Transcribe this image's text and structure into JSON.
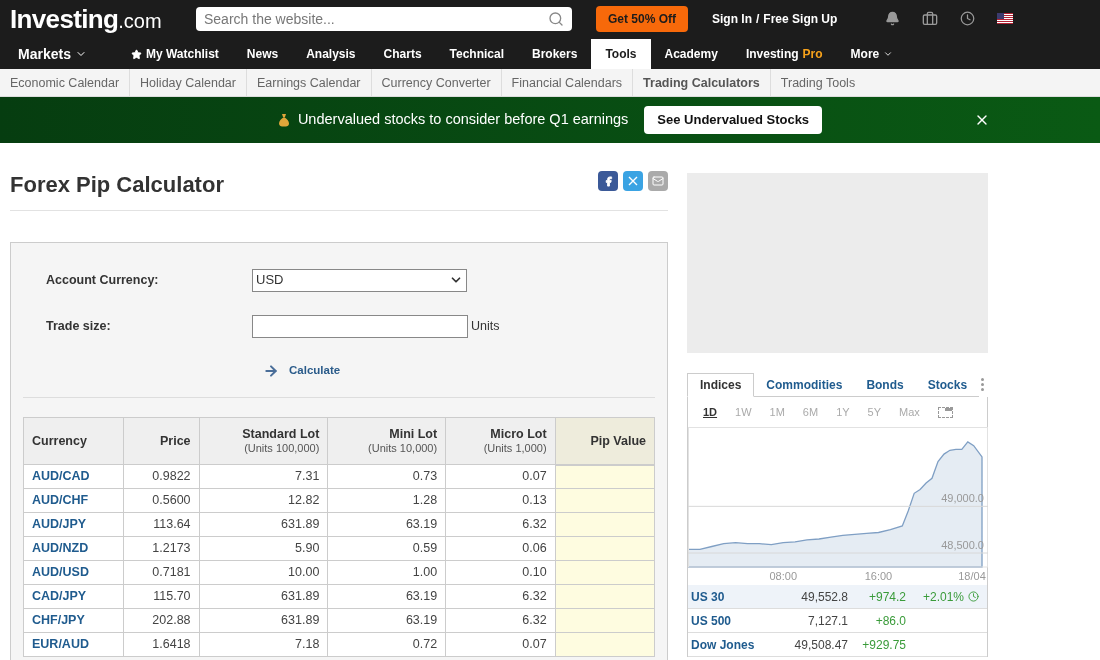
{
  "header": {
    "logo_main": "Investing",
    "logo_suffix": ".com",
    "search": {
      "placeholder": "Search the website..."
    },
    "promo_button": "Get 50% Off",
    "sign_in": "Sign In",
    "separator": "/",
    "sign_up": "Free Sign Up"
  },
  "nav": [
    {
      "label": "Markets",
      "selected": false,
      "kind": "dropdown"
    },
    {
      "label": "My Watchlist",
      "selected": false,
      "kind": "star"
    },
    {
      "label": "News",
      "selected": false,
      "kind": "plain"
    },
    {
      "label": "Analysis",
      "selected": false,
      "kind": "plain"
    },
    {
      "label": "Charts",
      "selected": false,
      "kind": "plain"
    },
    {
      "label": "Technical",
      "selected": false,
      "kind": "plain"
    },
    {
      "label": "Brokers",
      "selected": false,
      "kind": "plain"
    },
    {
      "label": "Tools",
      "selected": true,
      "kind": "plain"
    },
    {
      "label": "Academy",
      "selected": false,
      "kind": "plain"
    },
    {
      "label": "Investing",
      "label_accent": "Pro",
      "selected": false,
      "kind": "pro"
    },
    {
      "label": "More",
      "selected": false,
      "kind": "caret"
    }
  ],
  "subnav": [
    {
      "label": "Economic Calendar",
      "selected": false
    },
    {
      "label": "Holiday Calendar",
      "selected": false
    },
    {
      "label": "Earnings Calendar",
      "selected": false
    },
    {
      "label": "Currency Converter",
      "selected": false
    },
    {
      "label": "Financial Calendars",
      "selected": false
    },
    {
      "label": "Trading Calculators",
      "selected": true
    },
    {
      "label": "Trading Tools",
      "selected": false
    }
  ],
  "banner": {
    "text": "Undervalued stocks to consider before Q1 earnings",
    "button": "See Undervalued Stocks"
  },
  "page_title": "Forex Pip Calculator",
  "form": {
    "currency_label": "Account Currency:",
    "currency_value": "USD",
    "trade_size_label": "Trade size:",
    "trade_size_unit": "Units",
    "calculate": "Calculate"
  },
  "table": {
    "columns": [
      {
        "title": "Currency"
      },
      {
        "title": "Price"
      },
      {
        "title": "Standard Lot",
        "subtitle": "(Units 100,000)"
      },
      {
        "title": "Mini Lot",
        "subtitle": "(Units 10,000)"
      },
      {
        "title": "Micro Lot",
        "subtitle": "(Units 1,000)"
      },
      {
        "title": "Pip Value"
      }
    ],
    "rows": [
      [
        "AUD/CAD",
        "0.9822",
        "7.31",
        "0.73",
        "0.07"
      ],
      [
        "AUD/CHF",
        "0.5600",
        "12.82",
        "1.28",
        "0.13"
      ],
      [
        "AUD/JPY",
        "113.64",
        "631.89",
        "63.19",
        "6.32"
      ],
      [
        "AUD/NZD",
        "1.2173",
        "5.90",
        "0.59",
        "0.06"
      ],
      [
        "AUD/USD",
        "0.7181",
        "10.00",
        "1.00",
        "0.10"
      ],
      [
        "CAD/JPY",
        "115.70",
        "631.89",
        "63.19",
        "6.32"
      ],
      [
        "CHF/JPY",
        "202.88",
        "631.89",
        "63.19",
        "6.32"
      ],
      [
        "EUR/AUD",
        "1.6418",
        "7.18",
        "0.72",
        "0.07"
      ]
    ]
  },
  "markets": {
    "tabs": [
      {
        "label": "Indices",
        "selected": true
      },
      {
        "label": "Commodities",
        "selected": false
      },
      {
        "label": "Bonds",
        "selected": false
      },
      {
        "label": "Stocks",
        "selected": false
      }
    ],
    "periods": [
      {
        "label": "1D",
        "selected": true
      },
      {
        "label": "1W",
        "selected": false
      },
      {
        "label": "1M",
        "selected": false
      },
      {
        "label": "6M",
        "selected": false
      },
      {
        "label": "1Y",
        "selected": false
      },
      {
        "label": "5Y",
        "selected": false
      },
      {
        "label": "Max",
        "selected": false
      }
    ],
    "chart_data": {
      "type": "area",
      "x": [
        0,
        1,
        2,
        3,
        4,
        5,
        6,
        7,
        8,
        9,
        10,
        11,
        12,
        13,
        14,
        15,
        16,
        17,
        18,
        18.5,
        19,
        19.5,
        20,
        20.5,
        21,
        21.5,
        22,
        22.5,
        23,
        23.5,
        24,
        24.7
      ],
      "series": [
        {
          "color": "#7f9fc4",
          "values": [
            48540,
            48540,
            48570,
            48600,
            48610,
            48600,
            48600,
            48590,
            48610,
            48620,
            48640,
            48650,
            48670,
            48690,
            48700,
            48710,
            48720,
            48750,
            48790,
            48950,
            49140,
            49180,
            49250,
            49300,
            49480,
            49560,
            49600,
            49610,
            49610,
            49690,
            49650,
            49530
          ]
        }
      ],
      "xlim": [
        0,
        25.2
      ],
      "ylim": [
        48350,
        49850
      ],
      "xticks": [
        {
          "value": 8,
          "label": "08:00"
        },
        {
          "value": 16,
          "label": "16:00"
        },
        {
          "value": 24,
          "label": "18/04"
        }
      ],
      "yticks": [
        {
          "value": 49000,
          "label": "49,000.0"
        },
        {
          "value": 48500,
          "label": "48,500.0"
        }
      ]
    },
    "quotes": [
      {
        "name": "US 30",
        "last": "49,552.8",
        "change": "+974.2",
        "percent": "+2.01%",
        "selected": true
      },
      {
        "name": "US 500",
        "last": "7,127.1",
        "change": "+86.0",
        "selected": false
      },
      {
        "name": "Dow Jones",
        "last": "49,508.47",
        "change": "+929.75",
        "selected": false
      }
    ]
  }
}
